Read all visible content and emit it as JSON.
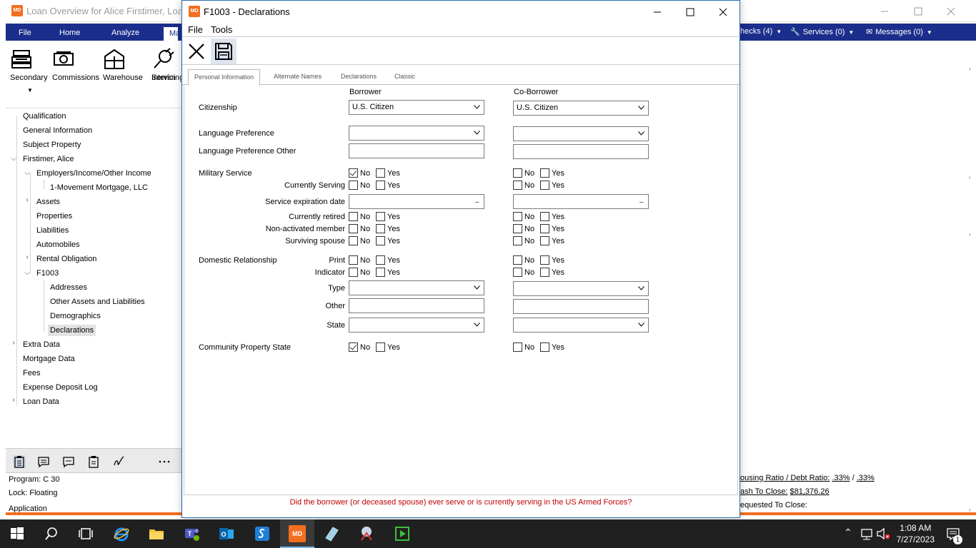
{
  "background_window": {
    "title": "Loan Overview for Alice Firstimer, Loan N",
    "app_icon_text": "MD",
    "ribbon_tabs": [
      "File",
      "Home",
      "Analyze",
      "Ma"
    ],
    "ribbon_right": [
      "hecks (4)",
      "Services (0)",
      "Messages (0)"
    ],
    "toolbar": [
      {
        "label": "Secondary",
        "icon": "cash-register-icon"
      },
      {
        "label": "Commissions",
        "icon": "money-icon"
      },
      {
        "label": "Warehouse",
        "icon": "warehouse-icon"
      },
      {
        "label": "Interim",
        "label2": "Servicing",
        "icon": "plug-icon"
      }
    ],
    "tree": [
      "Qualification",
      "General Information",
      "Subject Property",
      "Firstimer, Alice",
      "Employers/Income/Other Income",
      "1-Movement Mortgage, LLC",
      "Assets",
      "Properties",
      "Liabilities",
      "Automobiles",
      "Rental Obligation",
      "F1003",
      "Addresses",
      "Other Assets and Liabilities",
      "Demographics",
      "Declarations",
      "Extra Data",
      "Mortgage Data",
      "Fees",
      "Expense Deposit Log",
      "Loan Data"
    ],
    "status": {
      "program": "Program: C 30",
      "lock": "Lock: Floating",
      "application": "Application"
    },
    "right_status": {
      "ratio_label": "ousing Ratio / Debt Ratio:",
      "ratio1": ".33%",
      "ratio_sep": "/",
      "ratio2": ".33%",
      "cash_label": "ash To Close:",
      "cash_value": "$81,376.26",
      "requested": "equested To Close:"
    }
  },
  "dialog": {
    "icon_text": "MD",
    "title": "F1003 - Declarations",
    "menu": [
      "File",
      "Tools"
    ],
    "tabs": [
      "Personal Information",
      "Alternate Names",
      "Declarations",
      "Classic"
    ],
    "columns": {
      "borrower": "Borrower",
      "coborrower": "Co-Borrower"
    },
    "labels": {
      "citizenship": "Citizenship",
      "language": "Language Preference",
      "language_other": "Language Preference Other",
      "military": "Military Service",
      "currently_serving": "Currently Serving",
      "service_exp": "Service expiration date",
      "currently_retired": "Currently retired",
      "non_activated": "Non-activated member",
      "surviving": "Surviving spouse",
      "domestic": "Domestic Relationship",
      "print": "Print",
      "indicator": "Indicator",
      "type": "Type",
      "other": "Other",
      "state": "State",
      "community": "Community Property State"
    },
    "borrower": {
      "citizenship": "U.S. Citizen"
    },
    "coborrower": {
      "citizenship": "U.S. Citizen"
    },
    "no": "No",
    "yes": "Yes",
    "ellipsis": "...",
    "footer": "Did the borrower (or deceased spouse) ever serve or is currently serving in the US Armed Forces?"
  },
  "taskbar": {
    "time": "1:08 AM",
    "date": "7/27/2023",
    "active_app": "MD",
    "notification_count": "1"
  }
}
